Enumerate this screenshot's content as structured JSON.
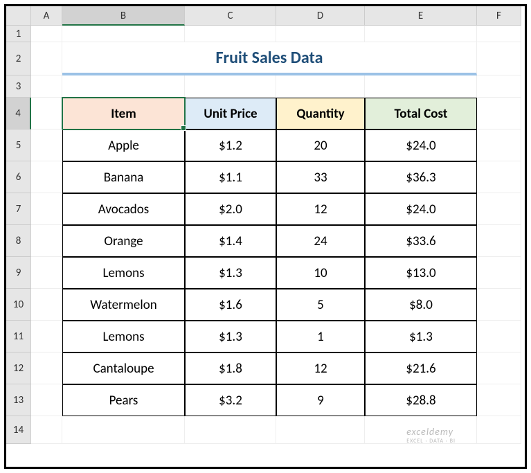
{
  "columns": [
    "A",
    "B",
    "C",
    "D",
    "E",
    "F"
  ],
  "rows": [
    "1",
    "2",
    "3",
    "4",
    "5",
    "6",
    "7",
    "8",
    "9",
    "10",
    "11",
    "12",
    "13",
    "14"
  ],
  "selectedCell": "B4",
  "title": "Fruit Sales Data",
  "headers": {
    "item": "Item",
    "unitPrice": "Unit Price",
    "quantity": "Quantity",
    "totalCost": "Total Cost"
  },
  "data": [
    {
      "item": "Apple",
      "unitPrice": "$1.2",
      "quantity": "20",
      "totalCost": "$24.0"
    },
    {
      "item": "Banana",
      "unitPrice": "$1.1",
      "quantity": "33",
      "totalCost": "$36.3"
    },
    {
      "item": "Avocados",
      "unitPrice": "$2.0",
      "quantity": "12",
      "totalCost": "$24.0"
    },
    {
      "item": "Orange",
      "unitPrice": "$1.4",
      "quantity": "24",
      "totalCost": "$33.6"
    },
    {
      "item": "Lemons",
      "unitPrice": "$1.3",
      "quantity": "10",
      "totalCost": "$13.0"
    },
    {
      "item": "Watermelon",
      "unitPrice": "$1.6",
      "quantity": "5",
      "totalCost": "$8.0"
    },
    {
      "item": "Lemons",
      "unitPrice": "$1.3",
      "quantity": "1",
      "totalCost": "$1.3"
    },
    {
      "item": "Cantaloupe",
      "unitPrice": "$1.8",
      "quantity": "12",
      "totalCost": "$21.6"
    },
    {
      "item": "Pears",
      "unitPrice": "$3.2",
      "quantity": "9",
      "totalCost": "$28.8"
    }
  ],
  "watermark": {
    "main": "exceldemy",
    "sub": "EXCEL · DATA · BI"
  },
  "chart_data": {
    "type": "table",
    "title": "Fruit Sales Data",
    "columns": [
      "Item",
      "Unit Price",
      "Quantity",
      "Total Cost"
    ],
    "rows": [
      [
        "Apple",
        1.2,
        20,
        24.0
      ],
      [
        "Banana",
        1.1,
        33,
        36.3
      ],
      [
        "Avocados",
        2.0,
        12,
        24.0
      ],
      [
        "Orange",
        1.4,
        24,
        33.6
      ],
      [
        "Lemons",
        1.3,
        10,
        13.0
      ],
      [
        "Watermelon",
        1.6,
        5,
        8.0
      ],
      [
        "Lemons",
        1.3,
        1,
        1.3
      ],
      [
        "Cantaloupe",
        1.8,
        12,
        21.6
      ],
      [
        "Pears",
        3.2,
        9,
        28.8
      ]
    ]
  }
}
